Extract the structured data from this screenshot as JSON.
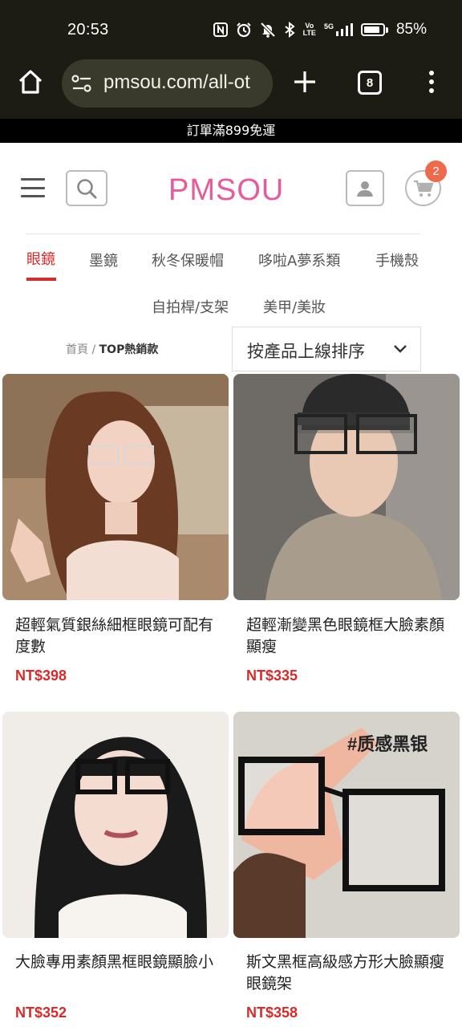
{
  "status_bar": {
    "time": "20:53",
    "battery": "85%",
    "battery_level": 0.85,
    "network_label_top": "Vo",
    "network_label_bottom": "LTE",
    "signal_label": "5G",
    "icons": [
      "nfc-icon",
      "alarm-icon",
      "mute-icon",
      "bluetooth-icon",
      "volte-icon",
      "signal-icon",
      "battery-icon"
    ]
  },
  "browser": {
    "url": "pmsou.com/all-ot",
    "tab_count": "8",
    "icons": [
      "home-icon",
      "tune-icon",
      "plus-icon",
      "tabs-icon",
      "more-vert-icon"
    ]
  },
  "promo": {
    "text": "訂單滿899免運"
  },
  "header": {
    "logo_text": "PMSOU",
    "cart_count": "2",
    "colors": {
      "logo": "#e85a9a",
      "badge": "#ef6a4a",
      "accent": "#d62b2b"
    },
    "icons": [
      "hamburger-icon",
      "search-icon",
      "user-icon",
      "cart-icon"
    ]
  },
  "categories": {
    "row1": [
      {
        "label": "眼鏡",
        "active": true
      },
      {
        "label": "墨鏡",
        "active": false
      },
      {
        "label": "秋冬保暖帽",
        "active": false
      },
      {
        "label": "哆啦A夢系類",
        "active": false
      },
      {
        "label": "手機殼",
        "active": false
      }
    ],
    "row2": [
      {
        "label": "自拍桿/支架",
        "active": false
      },
      {
        "label": "美甲/美妝",
        "active": false
      }
    ]
  },
  "breadcrumb": {
    "home": "首頁",
    "separator": "/",
    "current": "TOP熱銷款"
  },
  "sort": {
    "selected": "按產品上線排序"
  },
  "products": [
    {
      "title": "超輕氣質銀絲細框眼鏡可配有度數",
      "price": "NT$398"
    },
    {
      "title": "超輕漸變黑色眼鏡框大臉素顏顯瘦",
      "price": "NT$335"
    },
    {
      "title": "大臉專用素顏黑框眼鏡顯臉小",
      "price": "NT$352"
    },
    {
      "title": "斯文黑框高級感方形大臉顯瘦眼鏡架",
      "price": "NT$358",
      "image_caption": "#质感黑银"
    }
  ]
}
